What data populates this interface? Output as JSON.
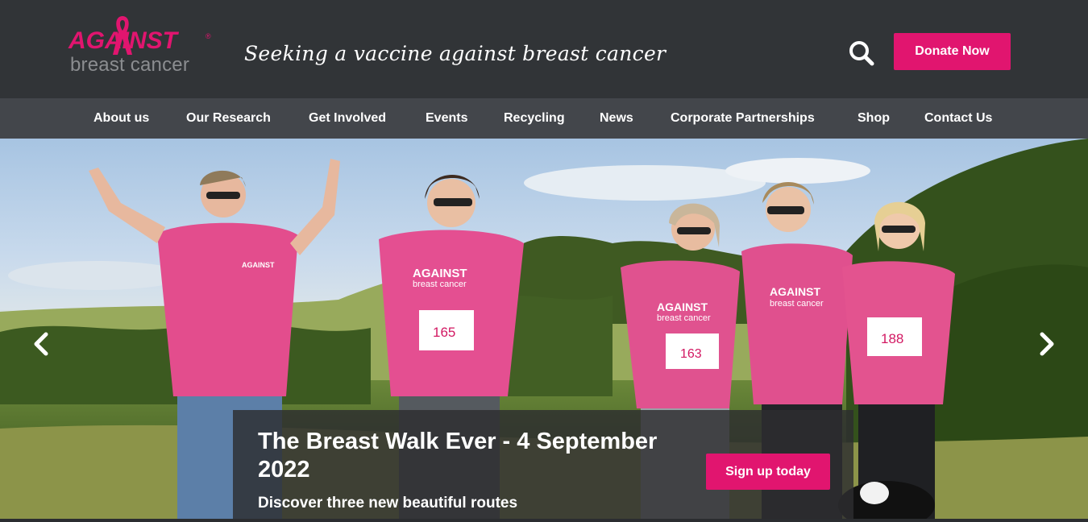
{
  "brand": {
    "logo_top": "AGAINST",
    "logo_bottom": "breast cancer",
    "logo_reg": "®",
    "tagline": "Seeking a vaccine against breast cancer",
    "accent_color": "#e1156f"
  },
  "header": {
    "search_icon": "search-icon",
    "donate_label": "Donate Now"
  },
  "nav": {
    "items": [
      {
        "label": "About us"
      },
      {
        "label": "Our Research"
      },
      {
        "label": "Get Involved"
      },
      {
        "label": "Events"
      },
      {
        "label": "Recycling"
      },
      {
        "label": "News"
      },
      {
        "label": "Corporate Partnerships"
      },
      {
        "label": "Shop"
      },
      {
        "label": "Contact Us"
      }
    ]
  },
  "hero": {
    "prev_icon": "chevron-left-icon",
    "next_icon": "chevron-right-icon",
    "title": "The Breast Walk Ever - 4 September 2022",
    "subtitle": "Discover three new beautiful routes",
    "cta_label": "Sign up today",
    "photo": {
      "shirt_text_top": "AGAINST",
      "shirt_text_bottom": "breast cancer",
      "bibs": [
        "165",
        "163",
        "188"
      ]
    }
  }
}
